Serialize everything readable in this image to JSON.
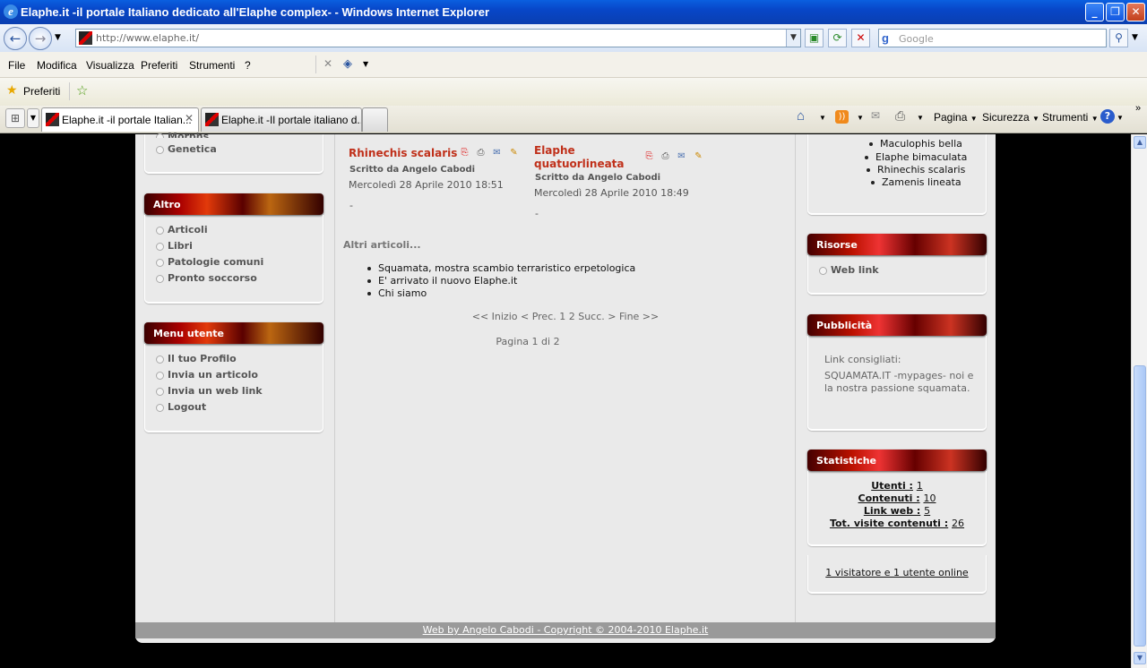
{
  "window": {
    "title": "Elaphe.it -il portale Italiano dedicato all'Elaphe complex- - Windows Internet Explorer",
    "url": "http://www.elaphe.it/",
    "search_placeholder": "Google"
  },
  "menu": [
    "File",
    "Modifica",
    "Visualizza",
    "Preferiti",
    "Strumenti",
    "?"
  ],
  "favorites_label": "Preferiti",
  "tabs": [
    {
      "label": "Elaphe.it -il portale Italian..."
    },
    {
      "label": "Elaphe.it -Il portale italiano d..."
    }
  ],
  "commands": {
    "page": "Pagina",
    "security": "Sicurezza",
    "tools": "Strumenti"
  },
  "left": {
    "partial_items": [
      "Morphs",
      "Genetica"
    ],
    "altro": {
      "title": "Altro",
      "items": [
        "Articoli",
        "Libri",
        "Patologie comuni",
        "Pronto soccorso"
      ]
    },
    "menu_utente": {
      "title": "Menu utente",
      "items": [
        "Il tuo Profilo",
        "Invia un articolo",
        "Invia un web link",
        "Logout"
      ]
    }
  },
  "main": {
    "articles": [
      {
        "title": "Rhinechis scalaris",
        "author": "Scritto da Angelo Cabodi",
        "date": "Mercoledì 28 Aprile 2010 18:51",
        "body": "-"
      },
      {
        "title": "Elaphe quatuorlineata",
        "author": "Scritto da Angelo Cabodi",
        "date": "Mercoledì 28 Aprile 2010 18:49",
        "body": "-"
      }
    ],
    "more_heading": "Altri articoli...",
    "more_items": [
      "Squamata, mostra scambio terraristico erpetologica",
      "E' arrivato il nuovo Elaphe.it",
      "Chi siamo"
    ],
    "pagination": "<< Inizio < Prec. 1 2 Succ. > Fine >>",
    "page_info": "Pagina 1 di 2"
  },
  "right": {
    "species": [
      "Maculophis bella",
      "Elaphe bimaculata",
      "Rhinechis scalaris",
      "Zamenis lineata"
    ],
    "risorse": {
      "title": "Risorse",
      "items": [
        "Web link"
      ]
    },
    "pubblicita": {
      "title": "Pubblicità",
      "line1": "Link consigliati:",
      "line2": "SQUAMATA.IT -mypages- noi e la nostra passione squamata."
    },
    "statistiche": {
      "title": "Statistiche",
      "rows": [
        {
          "label": "Utenti :",
          "value": "1"
        },
        {
          "label": "Contenuti :",
          "value": "10"
        },
        {
          "label": "Link web :",
          "value": "5"
        },
        {
          "label": "Tot. visite contenuti :",
          "value": "26"
        }
      ]
    },
    "online": "1 visitatore e 1 utente online"
  },
  "footer": "Web by Angelo Cabodi - Copyright © 2004-2010 Elaphe.it"
}
